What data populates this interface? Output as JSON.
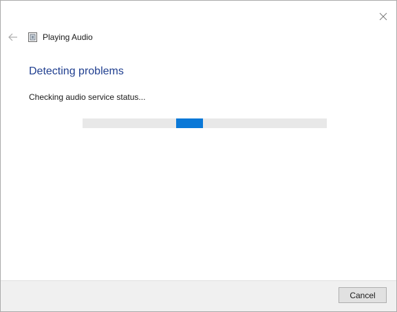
{
  "window": {
    "title": "Playing Audio"
  },
  "main": {
    "heading": "Detecting problems",
    "status": "Checking audio service status..."
  },
  "footer": {
    "cancel_label": "Cancel"
  },
  "icons": {
    "close": "close-icon",
    "back": "back-arrow-icon",
    "title": "troubleshooter-icon"
  },
  "colors": {
    "heading": "#1f3e8f",
    "progress": "#0a78d7",
    "track": "#e8e8e8",
    "footer": "#f0f0f0"
  }
}
